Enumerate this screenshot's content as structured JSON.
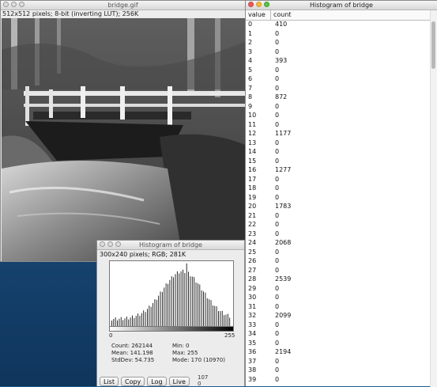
{
  "bridge_window": {
    "title": "bridge.gif",
    "info": "512x512 pixels; 8-bit (inverting LUT); 256K"
  },
  "small_histogram": {
    "title": "Histogram of bridge",
    "info": "300x240 pixels; RGB; 281K",
    "axis_min": "0",
    "axis_max": "255",
    "stats": {
      "count": "Count: 262144",
      "mean": "Mean: 141.198",
      "stddev": "StdDev: 54.735",
      "min": "Min: 0",
      "max": "Max: 255",
      "mode": "Mode: 170 (10970)"
    },
    "buttons": {
      "list": "List",
      "copy": "Copy",
      "log": "Log",
      "live": "Live"
    },
    "live_value_1": "107",
    "live_value_2": "0"
  },
  "list_window": {
    "title": "Histogram of bridge",
    "col_value": "value",
    "col_count": "count",
    "rows": [
      [
        "0",
        "410"
      ],
      [
        "1",
        "0"
      ],
      [
        "2",
        "0"
      ],
      [
        "3",
        "0"
      ],
      [
        "4",
        "393"
      ],
      [
        "5",
        "0"
      ],
      [
        "6",
        "0"
      ],
      [
        "7",
        "0"
      ],
      [
        "8",
        "872"
      ],
      [
        "9",
        "0"
      ],
      [
        "10",
        "0"
      ],
      [
        "11",
        "0"
      ],
      [
        "12",
        "1177"
      ],
      [
        "13",
        "0"
      ],
      [
        "14",
        "0"
      ],
      [
        "15",
        "0"
      ],
      [
        "16",
        "1277"
      ],
      [
        "17",
        "0"
      ],
      [
        "18",
        "0"
      ],
      [
        "19",
        "0"
      ],
      [
        "20",
        "1783"
      ],
      [
        "21",
        "0"
      ],
      [
        "22",
        "0"
      ],
      [
        "23",
        "0"
      ],
      [
        "24",
        "2068"
      ],
      [
        "25",
        "0"
      ],
      [
        "26",
        "0"
      ],
      [
        "27",
        "0"
      ],
      [
        "28",
        "2539"
      ],
      [
        "29",
        "0"
      ],
      [
        "30",
        "0"
      ],
      [
        "31",
        "0"
      ],
      [
        "32",
        "2099"
      ],
      [
        "33",
        "0"
      ],
      [
        "34",
        "0"
      ],
      [
        "35",
        "0"
      ],
      [
        "36",
        "2194"
      ],
      [
        "37",
        "0"
      ],
      [
        "38",
        "0"
      ],
      [
        "39",
        "0"
      ]
    ]
  },
  "colors": {
    "desktop": "#1b4f7f",
    "close": "#ec5a57",
    "minimize": "#f2b93e",
    "zoom": "#5dc04a"
  }
}
